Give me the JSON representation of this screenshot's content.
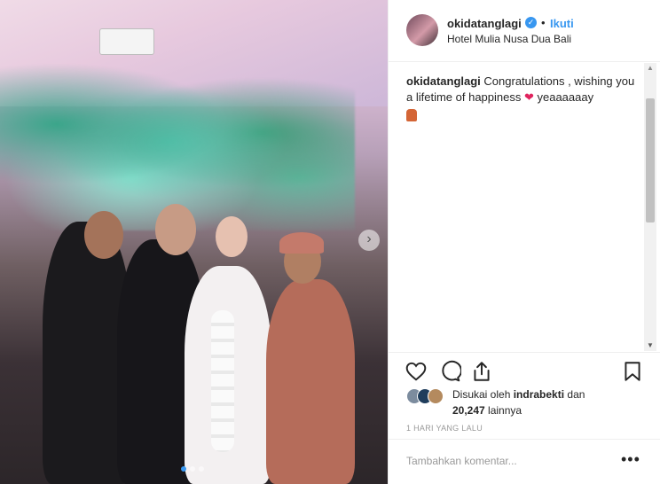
{
  "post": {
    "username": "okidatanglagi",
    "follow_label": "Ikuti",
    "bullet": "•",
    "location": "Hotel Mulia Nusa Dua Bali",
    "caption_user": "okidatanglagi",
    "caption_text": " Congratulations , wishing you a lifetime of happiness ",
    "caption_heart": "❤",
    "caption_tail": " yeaaaaaay",
    "likes_prefix": "Disukai oleh ",
    "likes_user": "indrabekti",
    "likes_mid": " dan",
    "likes_count": "20,247",
    "likes_suffix": " lainnya",
    "timestamp": "1 HARI YANG LALU",
    "comment_placeholder": "Tambahkan komentar...",
    "more_label": "•••"
  },
  "carousel": {
    "total_slides": 3,
    "active_index": 1
  },
  "icons": {
    "verified": "verified-badge-icon",
    "next": "chevron-right-icon",
    "like": "heart-icon",
    "comment": "comment-icon",
    "share": "share-icon",
    "save": "bookmark-icon"
  },
  "colors": {
    "accent": "#3897f0",
    "text": "#262626",
    "muted": "#999999",
    "heart": "#e0245e"
  }
}
